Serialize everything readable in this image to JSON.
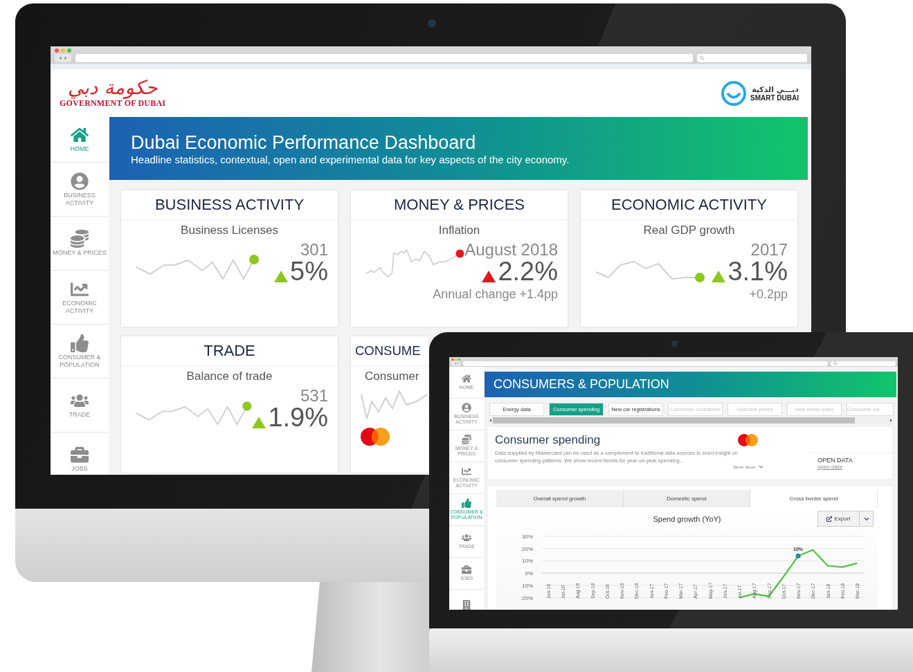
{
  "monitor": {
    "header": {
      "logo_arabic": "حكومة دبي",
      "logo_english": "GOVERNMENT OF DUBAI",
      "partner_arabic": "دبـــي الذكية",
      "partner_english": "SMART DUBAI"
    },
    "sidebar": {
      "items": [
        {
          "label": "HOME",
          "selected": true
        },
        {
          "label": "BUSINESS ACTIVITY",
          "selected": false
        },
        {
          "label": "MONEY & PRICES",
          "selected": false
        },
        {
          "label": "ECONOMIC ACTIVITY",
          "selected": false
        },
        {
          "label": "CONSUMER & POPULATION",
          "selected": false
        },
        {
          "label": "TRADE",
          "selected": false
        },
        {
          "label": "JOBS",
          "selected": false
        }
      ]
    },
    "banner": {
      "title": "Dubai Economic Performance Dashboard",
      "subtitle": "Headline statistics, contextual, open and experimental data for key aspects of the city economy."
    },
    "cards": [
      {
        "kind": "stat",
        "title": "BUSINESS ACTIVITY",
        "subtitle": "Business Licenses",
        "headline": "301",
        "value": "5%",
        "color": "#8cc81e"
      },
      {
        "kind": "stat",
        "title": "MONEY & PRICES",
        "subtitle": "Inflation",
        "headline": "August 2018",
        "value": "2.2%",
        "note": "Annual change +1.4pp",
        "color": "#e8141c"
      },
      {
        "kind": "stat",
        "title": "ECONOMIC ACTIVITY",
        "subtitle": "Real GDP growth",
        "headline": "2017",
        "value": "3.1%",
        "note": "+0.2pp",
        "color": "#8cc81e"
      },
      {
        "kind": "stat",
        "title": "TRADE",
        "subtitle": "Balance of trade",
        "headline": "531",
        "value": "1.9%",
        "color": "#8cc81e"
      },
      {
        "kind": "partner",
        "title": "CONSUME",
        "subtitle": "Consumer"
      }
    ]
  },
  "laptop": {
    "sidebar": {
      "items": [
        {
          "label": "HOME",
          "selected": false
        },
        {
          "label": "BUSINESS ACTIVITY",
          "selected": false
        },
        {
          "label": "MONEY & PRICES",
          "selected": false
        },
        {
          "label": "ECONOMIC ACTIVITY",
          "selected": false
        },
        {
          "label": "CONSUMER & POPULATION",
          "selected": true
        },
        {
          "label": "TRADE",
          "selected": false
        },
        {
          "label": "JOBS",
          "selected": false
        },
        {
          "selected": false
        }
      ]
    },
    "banner": {
      "title": "CONSUMERS & POPULATION"
    },
    "tabs": [
      {
        "label": "Energy data",
        "selected": false,
        "disabled": false
      },
      {
        "label": "Consumer spending",
        "selected": true,
        "disabled": false
      },
      {
        "label": "New car registrations",
        "selected": false,
        "disabled": false
      },
      {
        "label": "Consumer confidence",
        "selected": false,
        "disabled": true
      },
      {
        "label": "Gasoline prices",
        "selected": false,
        "disabled": true
      },
      {
        "label": "New home sales",
        "selected": false,
        "disabled": true
      },
      {
        "label": "Consumer cre",
        "selected": false,
        "disabled": true
      }
    ],
    "dataset": {
      "title": "Consumer spending",
      "description": "Data supplied by Mastercard can be used as a complement to traditional data sources to shed insight on consumer spending patterns.  We show recent trends for year-on-year spending...",
      "show_more": "Show more",
      "open_data_heading": "OPEN DATA",
      "open_data_link": "open data"
    },
    "chart_tabs": [
      {
        "label": "Overall spend growth",
        "selected": false
      },
      {
        "label": "Domestic spend",
        "selected": false
      },
      {
        "label": "Cross border spend",
        "selected": true
      }
    ],
    "export": "Export",
    "chart_data": {
      "type": "line",
      "title": "Spend growth (YoY)",
      "categories": [
        "Jun-16",
        "Jul-16",
        "Aug-16",
        "Sep-16",
        "Oct-16",
        "Nov-16",
        "Dec-16",
        "Jan-17",
        "Feb-17",
        "Mar-17",
        "Apr-17",
        "May-17",
        "Jun-17",
        "Jul-17",
        "Aug-17",
        "Sep-17",
        "Oct-17",
        "Nov-17",
        "Dec-17",
        "Jan-18",
        "Feb-18",
        "Mar-18"
      ],
      "series": [
        {
          "color": "#4cc23c",
          "values": [
            null,
            null,
            null,
            null,
            null,
            null,
            null,
            null,
            null,
            null,
            null,
            null,
            null,
            -20,
            -17,
            -19,
            -3,
            14,
            19,
            6,
            5,
            8
          ]
        }
      ],
      "ylim": [
        -20,
        30
      ],
      "grid": true,
      "yticks": [
        {
          "value": 30,
          "label": "30%"
        },
        {
          "value": 20,
          "label": "20%"
        },
        {
          "value": 10,
          "label": "10%"
        },
        {
          "value": 0,
          "label": "0%"
        },
        {
          "value": -10,
          "label": "10%"
        },
        {
          "value": -20,
          "label": "20%"
        }
      ],
      "annotations": [
        {
          "x": "Nov-17",
          "y": 14,
          "text": "10%"
        }
      ]
    }
  }
}
